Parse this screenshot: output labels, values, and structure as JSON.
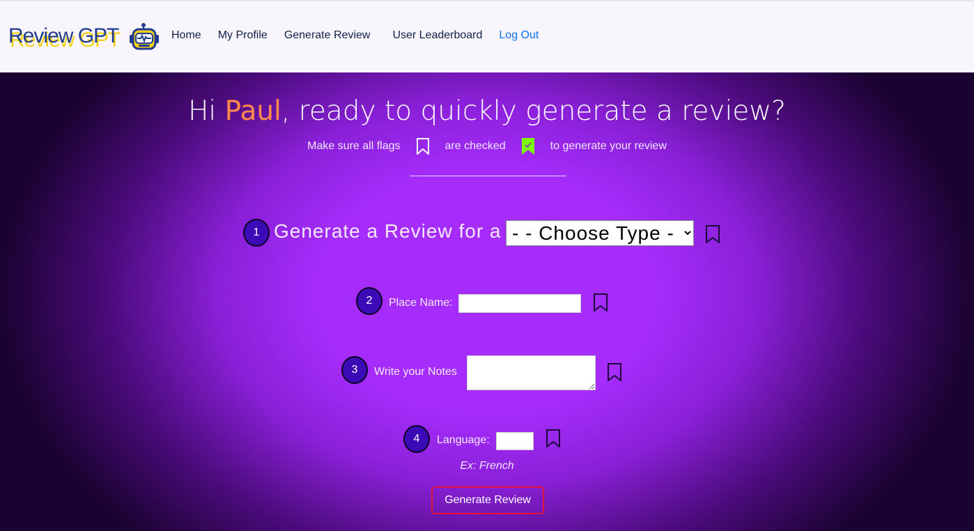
{
  "brand": {
    "name": "Review GPT"
  },
  "nav": {
    "home": "Home",
    "profile": "My Profile",
    "generate": "Generate Review",
    "leaderboard": "User Leaderboard",
    "logout": "Log Out"
  },
  "hero": {
    "greeting_prefix": "Hi",
    "user_name": "Paul",
    "greeting_suffix": ", ready to quickly generate a review?",
    "sub_part1": "Make sure all flags",
    "sub_part2": "are checked",
    "sub_part3": "to generate your review"
  },
  "steps": {
    "step1": {
      "number": "1",
      "label": "Generate a Review for a",
      "select_value": "- - Choose Type - -"
    },
    "step2": {
      "number": "2",
      "label": "Place Name:",
      "value": ""
    },
    "step3": {
      "number": "3",
      "label": "Write your Notes",
      "value": ""
    },
    "step4": {
      "number": "4",
      "label": "Language:",
      "value": "",
      "example": "Ex: French"
    }
  },
  "actions": {
    "generate_button": "Generate Review"
  },
  "colors": {
    "accent_name": "#ff8a4c",
    "step_circle": "#3d0ab8",
    "button_border": "#e3123a",
    "check_flag": "#7cfc00",
    "link": "#0d6efd"
  },
  "icons": [
    "robot-logo-icon",
    "bookmark-icon",
    "bookmark-check-icon"
  ]
}
